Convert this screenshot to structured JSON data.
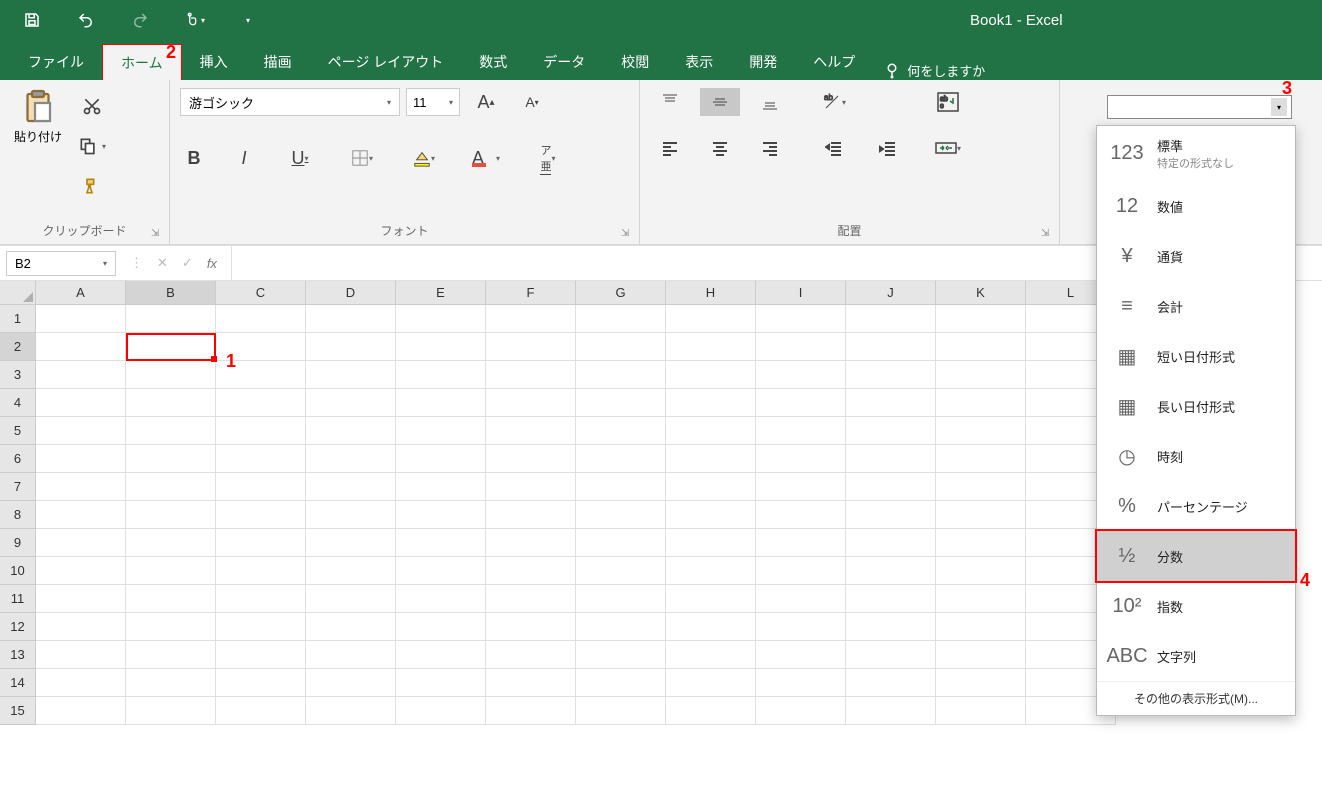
{
  "app_title": "Book1  -  Excel",
  "qat": {
    "save": "保存",
    "undo": "元に戻す",
    "redo": "やり直し",
    "touch": "タッチ/マウス",
    "more": "その他"
  },
  "tabs": {
    "file": "ファイル",
    "home": "ホーム",
    "insert": "挿入",
    "draw": "描画",
    "page_layout": "ページ レイアウト",
    "formulas": "数式",
    "data": "データ",
    "review": "校閲",
    "view": "表示",
    "developer": "開発",
    "help": "ヘルプ",
    "tellme": "何をしますか"
  },
  "ribbon": {
    "clipboard": {
      "label": "クリップボード",
      "paste": "貼り付け"
    },
    "font": {
      "label": "フォント",
      "name": "游ゴシック",
      "size": "11"
    },
    "alignment": {
      "label": "配置"
    }
  },
  "namebox": "B2",
  "columns": [
    "A",
    "B",
    "C",
    "D",
    "E",
    "F",
    "G",
    "H",
    "I",
    "J",
    "K",
    "L"
  ],
  "rows": [
    "1",
    "2",
    "3",
    "4",
    "5",
    "6",
    "7",
    "8",
    "9",
    "10",
    "11",
    "12",
    "13",
    "14",
    "15"
  ],
  "selected_col_index": 1,
  "selected_row_index": 1,
  "num_formats": [
    {
      "key": "general",
      "icon": "123",
      "label": "標準",
      "sub": "特定の形式なし"
    },
    {
      "key": "number",
      "icon": "12",
      "label": "数値",
      "sub": ""
    },
    {
      "key": "currency",
      "icon": "¥",
      "label": "通貨",
      "sub": ""
    },
    {
      "key": "accounting",
      "icon": "≡",
      "label": "会計",
      "sub": ""
    },
    {
      "key": "short_date",
      "icon": "▦",
      "label": "短い日付形式",
      "sub": ""
    },
    {
      "key": "long_date",
      "icon": "▦",
      "label": "長い日付形式",
      "sub": ""
    },
    {
      "key": "time",
      "icon": "◷",
      "label": "時刻",
      "sub": ""
    },
    {
      "key": "percentage",
      "icon": "%",
      "label": "パーセンテージ",
      "sub": ""
    },
    {
      "key": "fraction",
      "icon": "½",
      "label": "分数",
      "sub": ""
    },
    {
      "key": "scientific",
      "icon": "10²",
      "label": "指数",
      "sub": ""
    },
    {
      "key": "text",
      "icon": "ABC",
      "label": "文字列",
      "sub": ""
    }
  ],
  "num_format_more": "その他の表示形式(M)...",
  "callouts": {
    "c1": "1",
    "c2": "2",
    "c3": "3",
    "c4": "4"
  }
}
